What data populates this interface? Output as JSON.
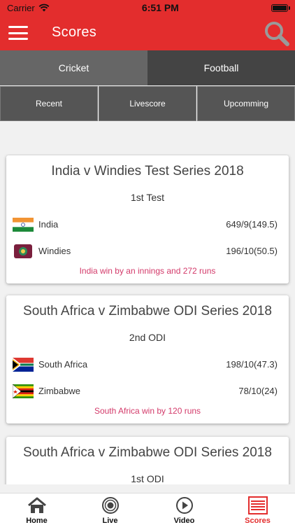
{
  "status_bar": {
    "carrier": "Carrier",
    "time": "6:51 PM"
  },
  "header": {
    "title": "Scores",
    "menu_icon": "hamburger-icon",
    "search_icon": "search-icon"
  },
  "sport_tabs": [
    {
      "label": "Cricket",
      "active": true
    },
    {
      "label": "Football",
      "active": false
    }
  ],
  "sub_tabs": [
    {
      "label": "Recent"
    },
    {
      "label": "Livescore"
    },
    {
      "label": "Upcomming"
    }
  ],
  "matches": [
    {
      "series": "India v Windies Test Series 2018",
      "match": "1st Test",
      "teams": [
        {
          "name": "India",
          "score": "649/9(149.5)",
          "flag": "india-flag-icon"
        },
        {
          "name": "Windies",
          "score": "196/10(50.5)",
          "flag": "windies-flag-icon"
        }
      ],
      "result": "India win by an innings and  272 runs"
    },
    {
      "series": "South Africa v Zimbabwe ODI Series 2018",
      "match": "2nd ODI",
      "teams": [
        {
          "name": "South Africa",
          "score": "198/10(47.3)",
          "flag": "south-africa-flag-icon"
        },
        {
          "name": "Zimbabwe",
          "score": "78/10(24)",
          "flag": "zimbabwe-flag-icon"
        }
      ],
      "result": "South Africa win by 120 runs"
    },
    {
      "series": "South Africa v Zimbabwe ODI Series 2018",
      "match": "1st ODI"
    }
  ],
  "tab_bar": [
    {
      "label": "Home",
      "icon": "home-icon",
      "active": false
    },
    {
      "label": "Live",
      "icon": "live-icon",
      "active": false
    },
    {
      "label": "Video",
      "icon": "video-icon",
      "active": false
    },
    {
      "label": "Scores",
      "icon": "scores-icon",
      "active": true
    }
  ],
  "colors": {
    "brand": "#e32d2d",
    "result_text": "#d33a6a",
    "tab_active": "#666666",
    "tab_inactive": "#444444"
  }
}
